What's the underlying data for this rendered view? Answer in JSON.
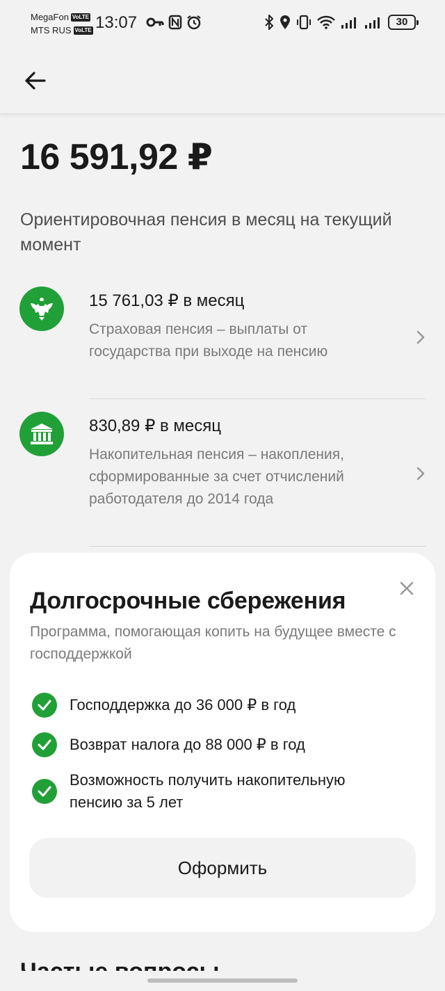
{
  "status_bar": {
    "carrier_1": "MegaFon",
    "carrier_2": "MTS RUS",
    "volte": "VoLTE",
    "time": "13:07",
    "battery": "30"
  },
  "header": {
    "back_icon": "arrow-left-icon"
  },
  "summary": {
    "amount": "16 591,92 ₽",
    "subtitle": "Ориентировочная пенсия в месяц на текущий момент"
  },
  "pensions": [
    {
      "icon": "emblem-icon",
      "title": "15 761,03 ₽ в месяц",
      "description": "Страховая пенсия – выплаты от государства при выходе на пенсию"
    },
    {
      "icon": "bank-building-icon",
      "title": "830,89 ₽ в месяц",
      "description": "Накопительная пенсия – накопления, сформированные за счет отчислений работодателя до 2014 года"
    }
  ],
  "promo": {
    "title": "Долгосрочные сбережения",
    "subtitle": "Программа, помогающая копить на будущее вместе с господдержкой",
    "features": [
      "Господдержка до 36 000 ₽ в год",
      "Возврат налога до 88 000 ₽ в год",
      "Возможность получить накопительную пенсию за 5 лет"
    ],
    "button": "Оформить"
  },
  "faq": {
    "title": "Частые вопросы"
  },
  "colors": {
    "accent": "#21a038",
    "background": "#f2f2f2",
    "card": "#ffffff"
  }
}
